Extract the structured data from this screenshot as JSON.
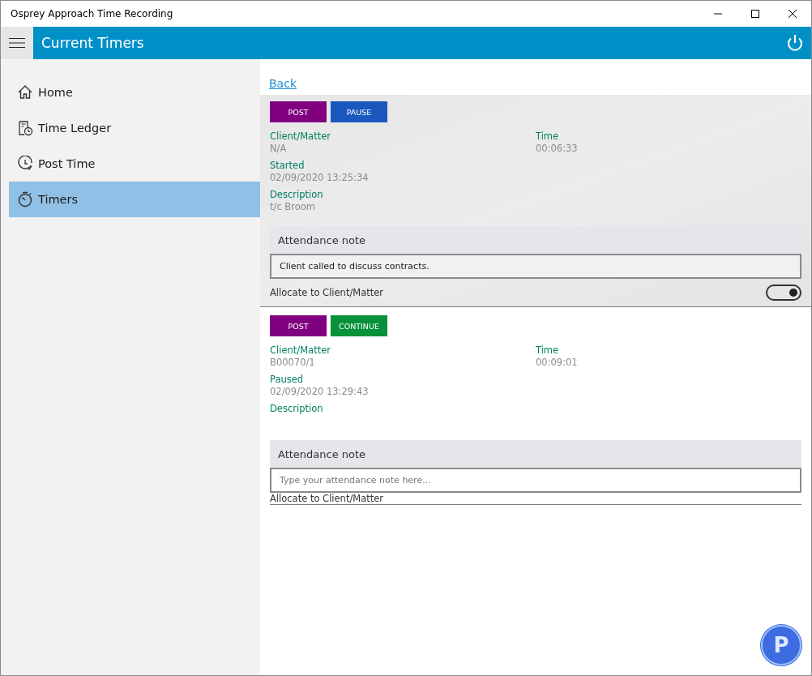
{
  "window": {
    "title": "Osprey Approach Time Recording"
  },
  "header": {
    "title": "Current Timers"
  },
  "sidebar": {
    "items": [
      {
        "label": "Home",
        "kind": "home",
        "selected": false
      },
      {
        "label": "Time Ledger",
        "kind": "ledger",
        "selected": false
      },
      {
        "label": "Post Time",
        "kind": "clock",
        "selected": false
      },
      {
        "label": "Timers",
        "kind": "stopwatch",
        "selected": true
      }
    ]
  },
  "back_link": "Back",
  "timers": [
    {
      "selected": true,
      "buttons": [
        {
          "label": "POST",
          "kind": "post"
        },
        {
          "label": "PAUSE",
          "kind": "pause"
        }
      ],
      "client_label": "Client/Matter",
      "client": "N/A",
      "time_label": "Time",
      "time": "00:06:33",
      "status_label": "Started",
      "status": "02/09/2020 13:25:34",
      "description_label": "Description",
      "description": "t/c Broom",
      "note_heading": "Attendance note",
      "note": {
        "value": "Client called to discuss contracts."
      },
      "allocate_label": "Allocate to Client/Matter",
      "allocate_toggle": {
        "on": true
      }
    },
    {
      "selected": false,
      "buttons": [
        {
          "label": "POST",
          "kind": "post"
        },
        {
          "label": "CONTINUE",
          "kind": "continue"
        }
      ],
      "client_label": "Client/Matter",
      "client": "B00070/1",
      "time_label": "Time",
      "time": "00:09:01",
      "status_label": "Paused",
      "status": "02/09/2020 13:29:43",
      "description_label": "Description",
      "note_heading": "Attendance note",
      "note": {
        "placeholder": "Type your attendance note here..."
      },
      "allocate_label": "Allocate to Client/Matter"
    }
  ],
  "logo": {
    "letter": "P"
  }
}
